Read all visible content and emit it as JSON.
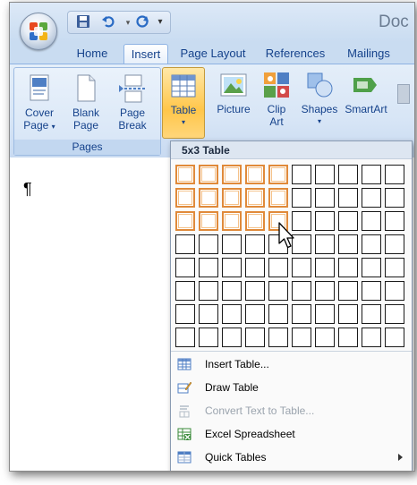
{
  "window": {
    "title": "Doc"
  },
  "quick_access": {
    "icons": [
      "save-icon",
      "undo-icon",
      "redo-icon",
      "customize-icon"
    ]
  },
  "tabs": [
    {
      "label": "Home",
      "active": false
    },
    {
      "label": "Insert",
      "active": true
    },
    {
      "label": "Page Layout",
      "active": false
    },
    {
      "label": "References",
      "active": false
    },
    {
      "label": "Mailings",
      "active": false
    }
  ],
  "ribbon": {
    "pages_group": {
      "label": "Pages",
      "buttons": [
        {
          "line1": "Cover",
          "line2": "Page",
          "caret": "▾"
        },
        {
          "line1": "Blank",
          "line2": "Page",
          "caret": ""
        },
        {
          "line1": "Page",
          "line2": "Break",
          "caret": ""
        }
      ]
    },
    "table_button": {
      "label": "Table",
      "caret": "▾"
    },
    "illustrations": [
      {
        "line1": "Picture",
        "line2": "",
        "caret": ""
      },
      {
        "line1": "Clip",
        "line2": "Art",
        "caret": ""
      },
      {
        "line1": "Shapes",
        "line2": "",
        "caret": "▾"
      },
      {
        "line1": "SmartArt",
        "line2": "",
        "caret": ""
      }
    ]
  },
  "document": {
    "pilcrow": "¶"
  },
  "table_dropdown": {
    "header": "5x3 Table",
    "grid": {
      "columns": 10,
      "rows": 8,
      "selected_columns": 5,
      "selected_rows": 3
    },
    "menu": [
      {
        "label": "Insert Table...",
        "icon": "insert-table-icon",
        "disabled": false,
        "submenu": false
      },
      {
        "label": "Draw Table",
        "icon": "draw-table-icon",
        "disabled": false,
        "submenu": false
      },
      {
        "label": "Convert Text to Table...",
        "icon": "convert-text-icon",
        "disabled": true,
        "submenu": false
      },
      {
        "label": "Excel Spreadsheet",
        "icon": "excel-icon",
        "disabled": false,
        "submenu": false
      },
      {
        "label": "Quick Tables",
        "icon": "quick-tables-icon",
        "disabled": false,
        "submenu": true
      }
    ]
  },
  "colors": {
    "accent": "#15428b",
    "selection": "#e08a3a",
    "ribbon": "#d7e5f6"
  }
}
